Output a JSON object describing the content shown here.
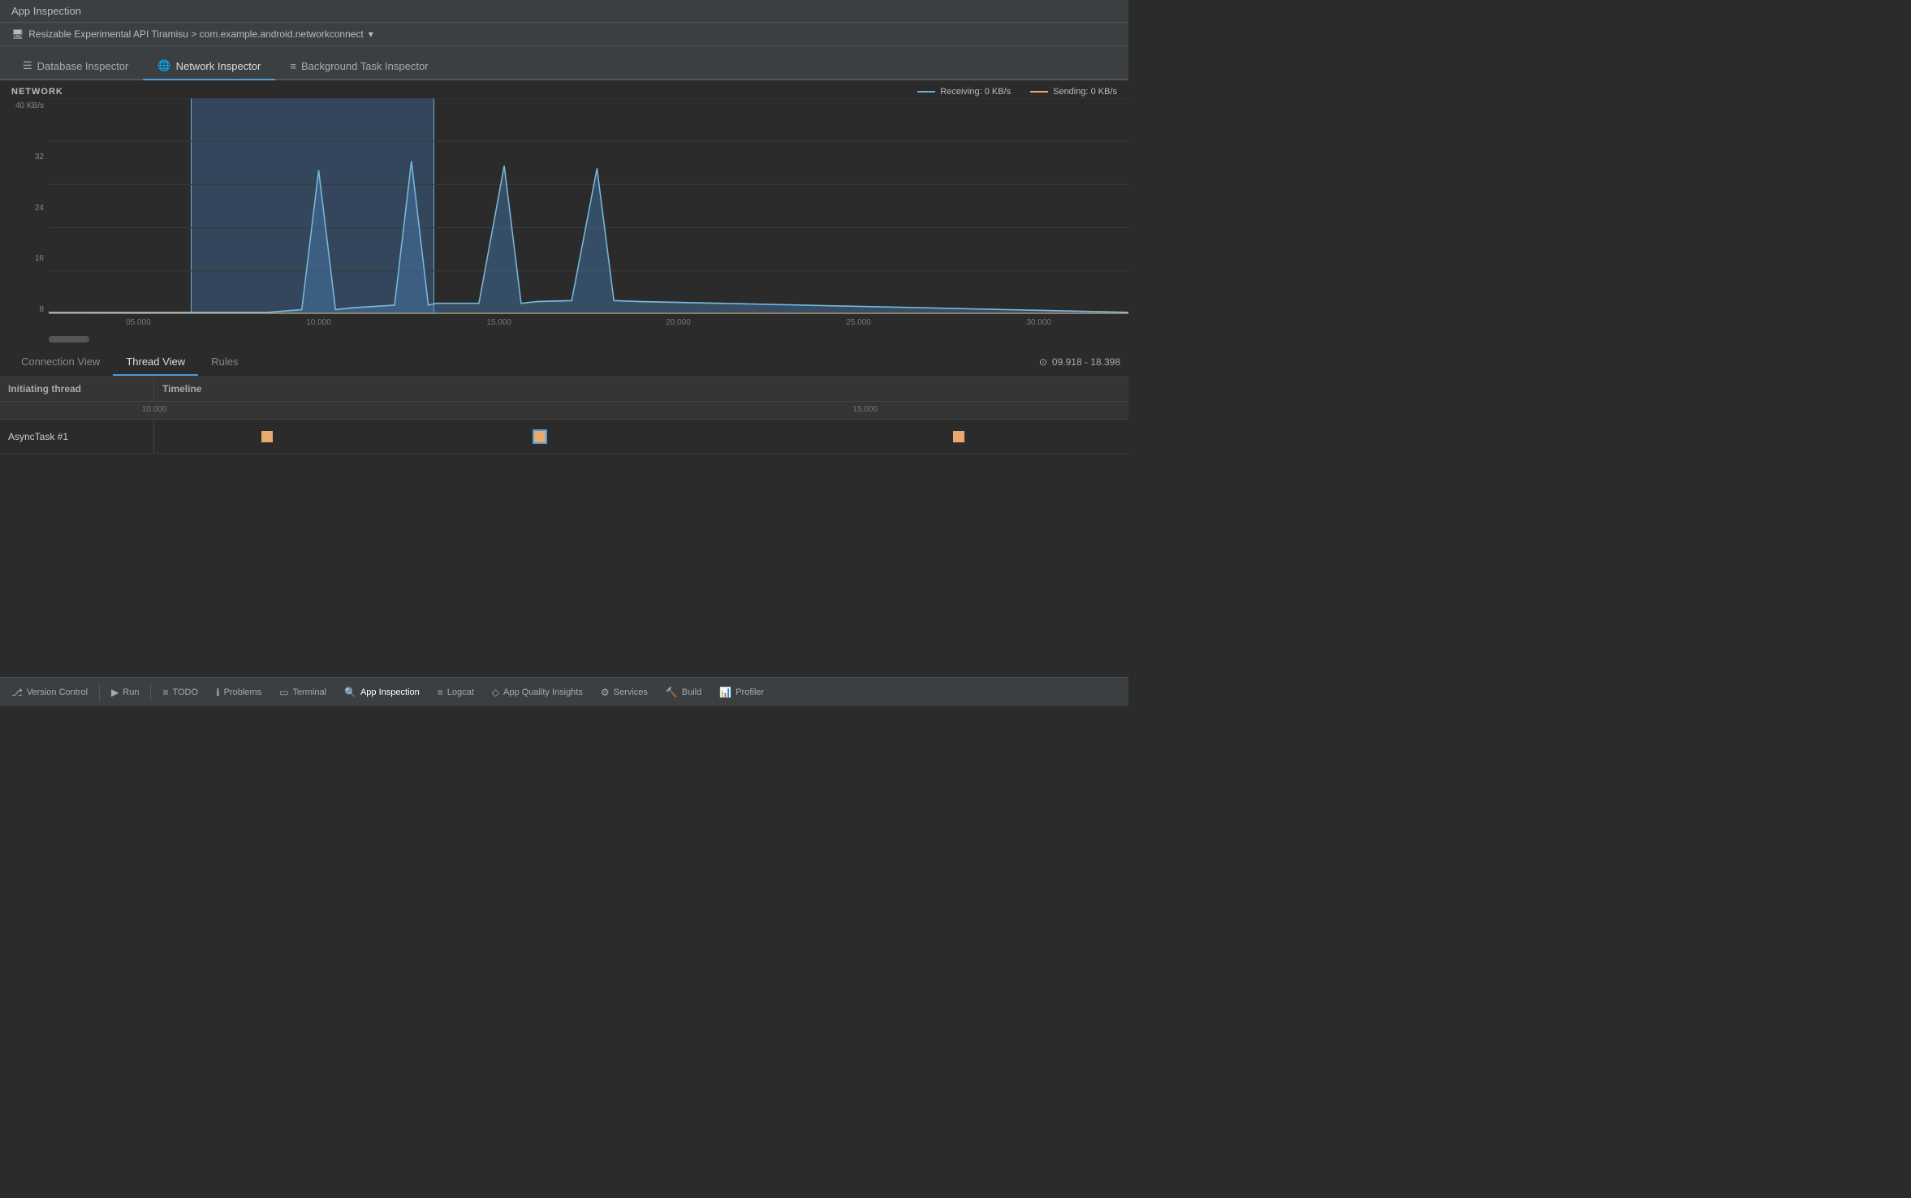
{
  "title_bar": {
    "label": "App Inspection"
  },
  "device": {
    "icon": "🖥",
    "name": "Resizable Experimental API Tiramisu > com.example.android.networkconnect",
    "chevron": "▾"
  },
  "tabs": [
    {
      "id": "database",
      "label": "Database Inspector",
      "icon": "☰",
      "active": false
    },
    {
      "id": "network",
      "label": "Network Inspector",
      "icon": "🌐",
      "active": true
    },
    {
      "id": "background",
      "label": "Background Task Inspector",
      "icon": "≡",
      "active": false
    }
  ],
  "chart": {
    "title": "NETWORK",
    "y_max_label": "40 KB/s",
    "y_labels": [
      "32",
      "24",
      "16",
      "8"
    ],
    "x_ticks": [
      {
        "label": "05.000",
        "pct": 8.3
      },
      {
        "label": "10.000",
        "pct": 25
      },
      {
        "label": "15.000",
        "pct": 41.7
      },
      {
        "label": "20.000",
        "pct": 58.3
      },
      {
        "label": "25.000",
        "pct": 75
      },
      {
        "label": "30.000",
        "pct": 91.7
      }
    ],
    "legend": {
      "receiving": "Receiving: 0 KB/s",
      "sending": "Sending: 0 KB/s"
    }
  },
  "view_tabs": [
    {
      "id": "connection",
      "label": "Connection View",
      "active": false
    },
    {
      "id": "thread",
      "label": "Thread View",
      "active": true
    },
    {
      "id": "rules",
      "label": "Rules",
      "active": false
    }
  ],
  "time_range": "09.918 - 18.398",
  "thread_table": {
    "col_thread": "Initiating thread",
    "col_timeline": "Timeline",
    "timeline_ticks": [
      {
        "label": "10.000",
        "pct": 0
      },
      {
        "label": "15.000",
        "pct": 63
      }
    ],
    "rows": [
      {
        "name": "AsyncTask #1",
        "tasks": [
          {
            "left_pct": 11,
            "selected": false
          },
          {
            "left_pct": 39,
            "selected": true
          },
          {
            "left_pct": 82,
            "selected": false
          }
        ]
      }
    ]
  },
  "bottom_toolbar": {
    "items": [
      {
        "id": "version-control",
        "icon": "⎇",
        "label": "Version Control"
      },
      {
        "id": "run",
        "icon": "▶",
        "label": "Run"
      },
      {
        "id": "todo",
        "icon": "≡",
        "label": "TODO"
      },
      {
        "id": "problems",
        "icon": "ℹ",
        "label": "Problems"
      },
      {
        "id": "terminal",
        "icon": "▭",
        "label": "Terminal"
      },
      {
        "id": "app-inspection",
        "icon": "🔍",
        "label": "App Inspection",
        "active": true
      },
      {
        "id": "logcat",
        "icon": "≡",
        "label": "Logcat"
      },
      {
        "id": "app-quality",
        "icon": "◇",
        "label": "App Quality Insights"
      },
      {
        "id": "services",
        "icon": "⚙",
        "label": "Services"
      },
      {
        "id": "build",
        "icon": "🔨",
        "label": "Build"
      },
      {
        "id": "profiler",
        "icon": "📊",
        "label": "Profiler"
      }
    ]
  }
}
